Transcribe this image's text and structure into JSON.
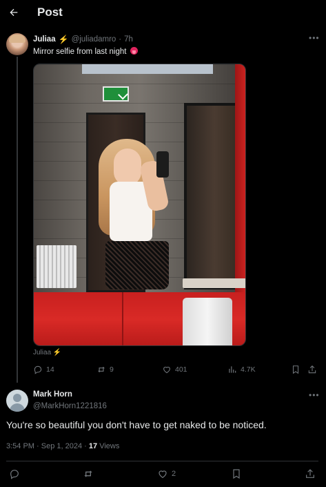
{
  "header": {
    "title": "Post",
    "back_icon": "arrow-left-icon"
  },
  "post": {
    "author_name": "Juliaa",
    "badge_icon": "lightning-bolt-icon",
    "handle": "@juliadamro",
    "time": "7h",
    "text": "Mirror selfie from last night",
    "emoji_icon": "tongue-face-emoji-icon",
    "photo_caption": "Juliaa",
    "stats": {
      "replies": "14",
      "reposts": "9",
      "likes": "401",
      "views": "4.7K"
    }
  },
  "reply": {
    "author_name": "Mark Horn",
    "handle": "@MarkHorn1221816",
    "text": "You're so beautiful you don't have to get naked to be noticed.",
    "time": "3:54 PM",
    "date": "Sep 1, 2024",
    "views_count": "17",
    "views_label": "Views",
    "stats": {
      "likes": "2"
    }
  },
  "colors": {
    "background": "#000000",
    "text": "#e7e9ea",
    "muted": "#71767b",
    "divider": "#2f3336",
    "verified_bolt": "#f4b400"
  }
}
